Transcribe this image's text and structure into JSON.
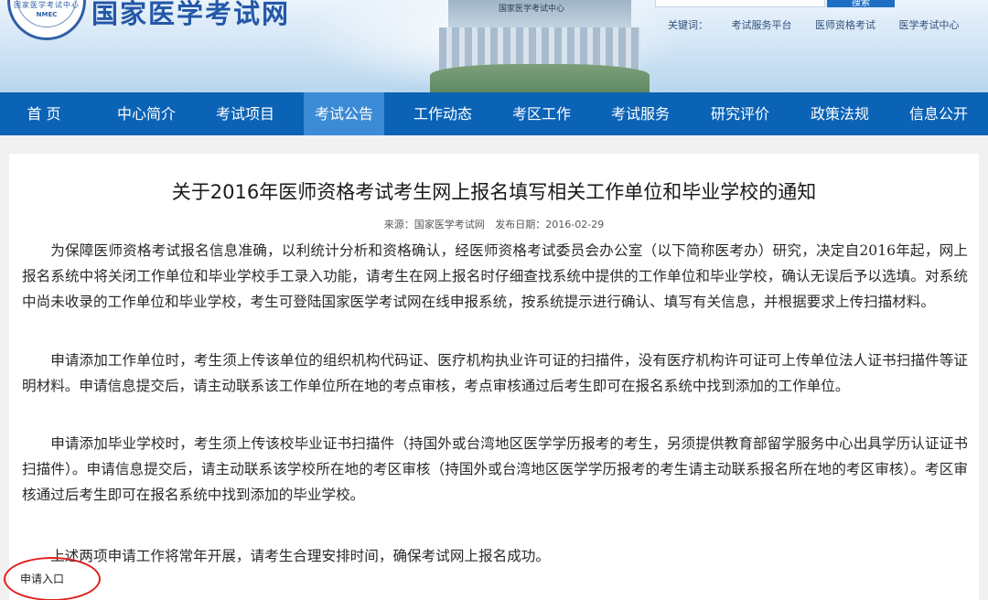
{
  "header": {
    "site_title": "国家医学考试网",
    "emblem_text_1": "国家医学考试中心",
    "emblem_text_2": "NMEC",
    "building_sign": "国家医学考试中心",
    "search_button_label": "搜索",
    "keywords_label": "关键词：",
    "keywords": [
      "考试服务平台",
      "医师资格考试",
      "医学考试中心"
    ]
  },
  "nav": {
    "items": [
      {
        "label": "首 页"
      },
      {
        "label": "中心简介"
      },
      {
        "label": "考试项目"
      },
      {
        "label": "考试公告",
        "active": true
      },
      {
        "label": "工作动态"
      },
      {
        "label": "考区工作"
      },
      {
        "label": "考试服务"
      },
      {
        "label": "研究评价"
      },
      {
        "label": "政策法规"
      },
      {
        "label": "信息公开"
      }
    ]
  },
  "article": {
    "title": "关于2016年医师资格考试考生网上报名填写相关工作单位和毕业学校的通知",
    "source": "来源：国家医学考试网",
    "date": "发布日期：2016-02-29",
    "paragraphs": [
      "为保障医师资格考试报名信息准确，以利统计分析和资格确认，经医师资格考试委员会办公室（以下简称医考办）研究，决定自2016年起，网上报名系统中将关闭工作单位和毕业学校手工录入功能，请考生在网上报名时仔细查找系统中提供的工作单位和毕业学校，确认无误后予以选填。对系统中尚未收录的工作单位和毕业学校，考生可登陆国家医学考试网在线申报系统，按系统提示进行确认、填写有关信息，并根据要求上传扫描材料。",
      "申请添加工作单位时，考生须上传该单位的组织机构代码证、医疗机构执业许可证的扫描件，没有医疗机构许可证可上传单位法人证书扫描件等证明材料。申请信息提交后，请主动联系该工作单位所在地的考点审核，考点审核通过后考生即可在报名系统中找到添加的工作单位。",
      "申请添加毕业学校时，考生须上传该校毕业证书扫描件（持国外或台湾地区医学学历报考的考生，另须提供教育部留学服务中心出具学历认证证书扫描件）。申请信息提交后，请主动联系该学校所在地的考区审核（持国外或台湾地区医学学历报考的考生请主动联系报名所在地的考区审核）。考区审核通过后考生即可在报名系统中找到添加的毕业学校。",
      "上述两项申请工作将常年开展，请考生合理安排时间，确保考试网上报名成功。"
    ],
    "apply_link": "申请入口"
  },
  "colors": {
    "nav_bg": "#0b63b6",
    "nav_active": "#3b8bd6",
    "title_blue": "#2458a8",
    "annotation_red": "#e02020"
  }
}
